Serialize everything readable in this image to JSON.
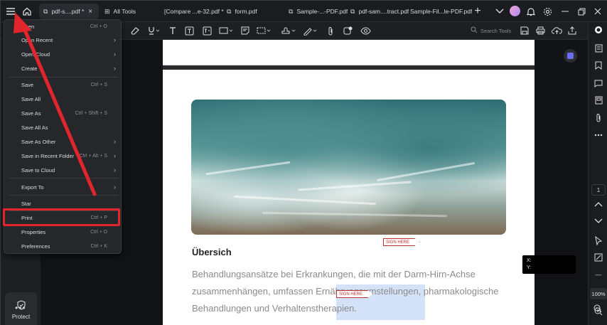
{
  "topbar": {
    "tabs": [
      {
        "label": "pdf-s....pdf *",
        "close": "×"
      },
      {
        "label": "All Tools"
      },
      {
        "label": "[Compare ...e-32.pdf *"
      },
      {
        "label": "form.pdf"
      },
      {
        "label": "Sample-...-PDF.pdf"
      },
      {
        "label": "pdf-sam....tract.pdf"
      },
      {
        "label": "Sample-Fil...le-PDF.pdf"
      }
    ],
    "add": "+"
  },
  "toolbar": {
    "search_placeholder": "Search Tools"
  },
  "menu": {
    "items": [
      {
        "label": "Open",
        "shortcut": "Ctrl + O"
      },
      {
        "label": "Open Recent",
        "arrow": "›"
      },
      {
        "label": "Open Cloud",
        "arrow": "›"
      },
      {
        "label": "Create",
        "arrow": "›"
      },
      {
        "label": "Save",
        "shortcut": "Ctrl + S"
      },
      {
        "label": "Save All"
      },
      {
        "label": "Save As",
        "shortcut": "Ctrl + Shift + S"
      },
      {
        "label": "Save All As"
      },
      {
        "label": "Save As Other",
        "arrow": "›"
      },
      {
        "label": "Save in Recent Folder",
        "shortcut": "Ctrl + Alt + S",
        "arrow": "›"
      },
      {
        "label": "Save to Cloud",
        "arrow": "›"
      },
      {
        "label": "Export To",
        "arrow": "›"
      },
      {
        "label": "Star"
      },
      {
        "label": "Print",
        "shortcut": "Ctrl + P"
      },
      {
        "label": "Properties",
        "shortcut": "Ctrl + D"
      },
      {
        "label": "Preferences",
        "shortcut": "Ctrl + K"
      }
    ]
  },
  "leftpanel": {
    "protect_label": "Protect",
    "more": "•••"
  },
  "document": {
    "heading": "Übersich",
    "body": "Behandlungsansätze bei Erkrankungen, die mit der Darm-Hirn-Achse zusammenhängen, umfassen Ernährungsumstellungen, pharmakologische Behandlungen und Verhaltenstherapien.",
    "sign1": "SIGN HERE",
    "sign2": "SIGN HERE"
  },
  "rightbar": {
    "page": "1",
    "zoom": "100%"
  },
  "coords": {
    "x": "X:",
    "y": "Y:"
  },
  "colors": {
    "highlight_box": "#e0252c",
    "arrow": "#e0252c",
    "accent": "#6b6cf5"
  }
}
